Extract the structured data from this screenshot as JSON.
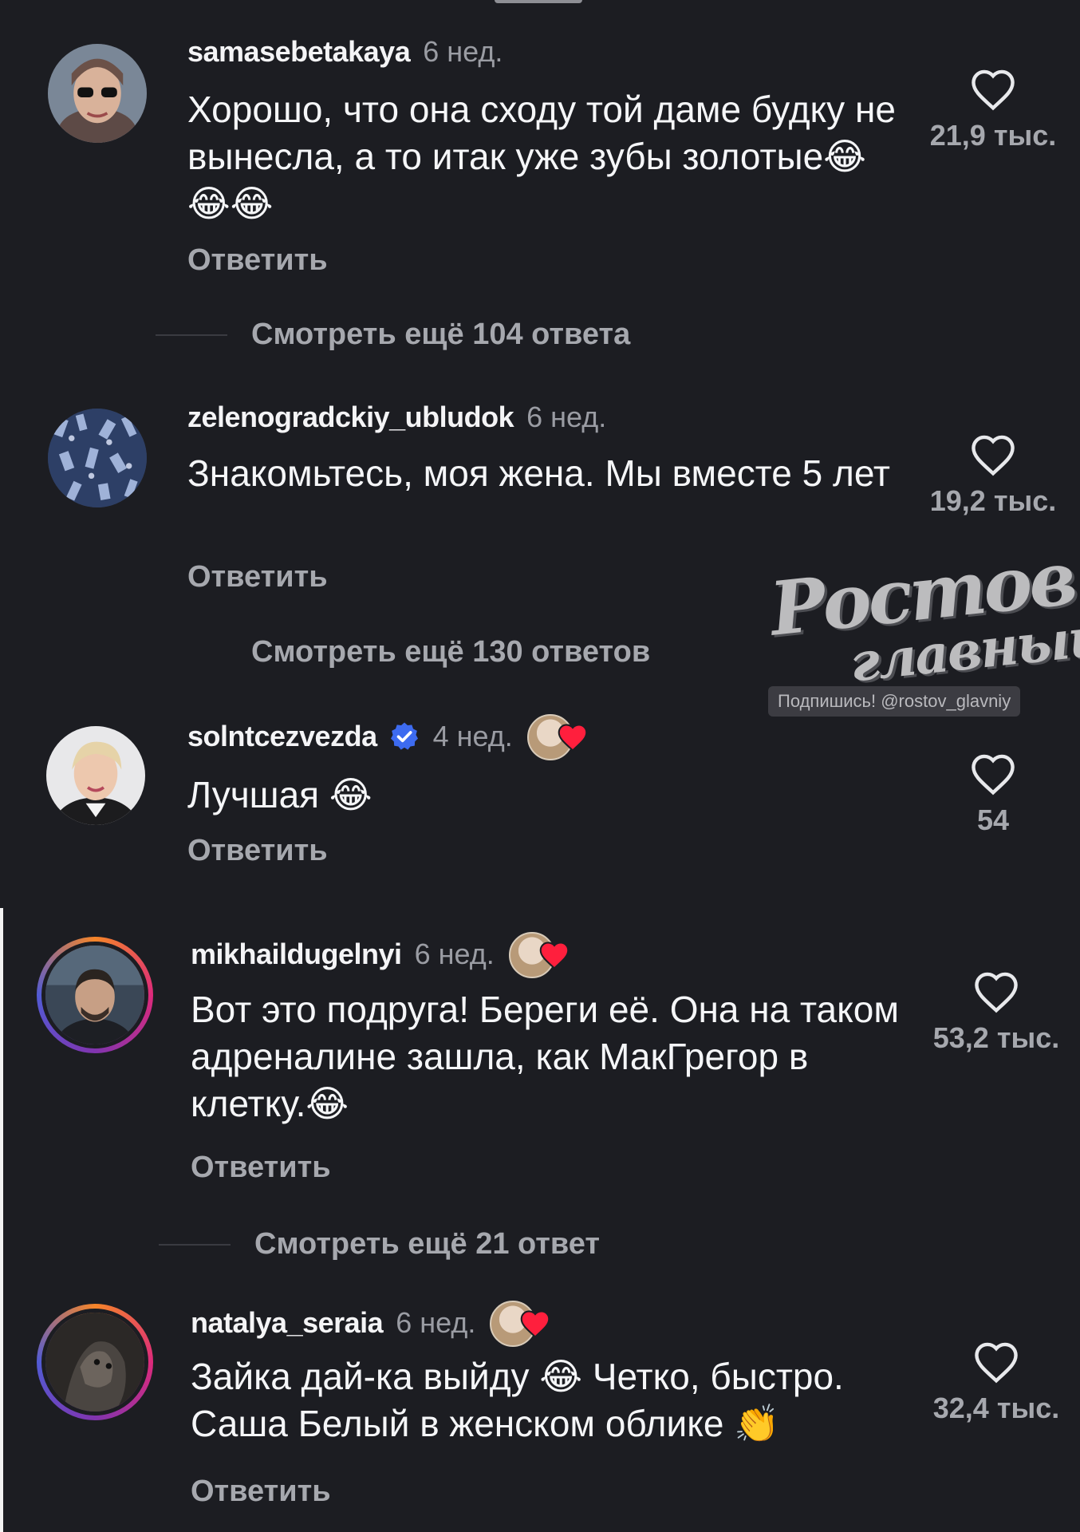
{
  "comments": [
    {
      "username": "samasebetakaya",
      "time": "6 нед.",
      "text": "Хорошо, что она сходу той даме будку не вынесла, а то итак уже зубы золотые😂😂😂",
      "reply_label": "Ответить",
      "likes": "21,9 тыс.",
      "more_replies": "Смотреть ещё 104 ответа"
    },
    {
      "username": "zelenogradckiy_ubludok",
      "time": "6 нед.",
      "text": "Знакомьтесь, моя жена. Мы вместе 5 лет",
      "reply_label": "Ответить",
      "likes": "19,2 тыс.",
      "more_replies": "Смотреть ещё 130 ответов"
    },
    {
      "username": "solntcezvezda",
      "time": "4 нед.",
      "verified": true,
      "liked_by_author": true,
      "text": "Лучшая 😂",
      "reply_label": "Ответить",
      "likes": "54"
    },
    {
      "username": "mikhaildugelnyi",
      "time": "6 нед.",
      "liked_by_author": true,
      "text": "Вот это подруга! Береги её. Она на таком адреналине зашла, как МакГрегор в клетку.😂",
      "reply_label": "Ответить",
      "likes": "53,2 тыс.",
      "more_replies": "Смотреть ещё 21 ответ"
    },
    {
      "username": "natalya_seraia",
      "time": "6 нед.",
      "liked_by_author": true,
      "text": "Зайка дай-ка выйду 😂 Четко, быстро. Саша Белый в женском облике 👏",
      "reply_label": "Ответить",
      "likes": "32,4 тыс."
    }
  ],
  "watermark": {
    "line1": "Ростов",
    "line2": "главный",
    "subtitle": "Подпишись! @rostov_glavniy"
  },
  "icons": {
    "like": "heart-outline-icon",
    "verified": "verified-badge-icon",
    "author_like": "red-heart-icon"
  },
  "colors": {
    "background": "#1c1d22",
    "muted_text": "#a6a8ae",
    "verified_blue": "#3d6bf0",
    "heart_red": "#ff1f3d"
  }
}
